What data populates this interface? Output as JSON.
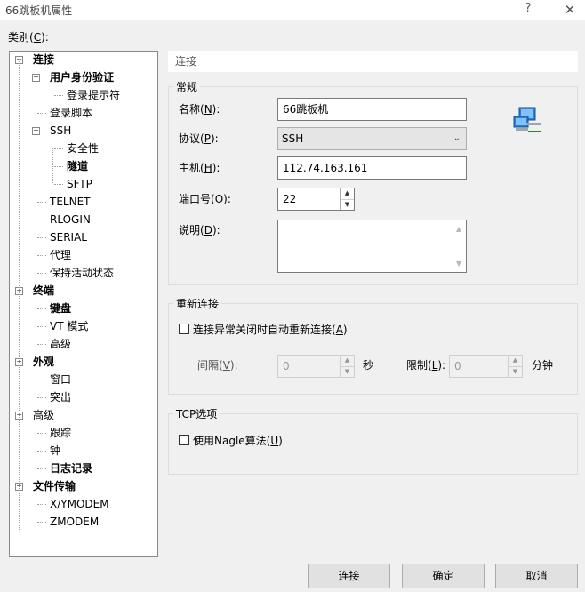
{
  "window": {
    "title": "66跳板机属性",
    "help": "?",
    "close": "✕"
  },
  "category_label": {
    "pre": "类别(",
    "key": "C",
    "post": "):"
  },
  "tree": [
    {
      "label": "连接",
      "bold": true
    },
    {
      "label": "用户身份验证",
      "bold": true
    },
    {
      "label": "登录提示符",
      "bold": false
    },
    {
      "label": "登录脚本",
      "bold": false
    },
    {
      "label": "SSH",
      "bold": false
    },
    {
      "label": "安全性",
      "bold": false
    },
    {
      "label": "隧道",
      "bold": true
    },
    {
      "label": "SFTP",
      "bold": false
    },
    {
      "label": "TELNET",
      "bold": false
    },
    {
      "label": "RLOGIN",
      "bold": false
    },
    {
      "label": "SERIAL",
      "bold": false
    },
    {
      "label": "代理",
      "bold": false
    },
    {
      "label": "保持活动状态",
      "bold": false
    },
    {
      "label": "终端",
      "bold": true
    },
    {
      "label": "键盘",
      "bold": true
    },
    {
      "label": "VT 模式",
      "bold": false
    },
    {
      "label": "高级",
      "bold": false
    },
    {
      "label": "外观",
      "bold": true
    },
    {
      "label": "窗口",
      "bold": false
    },
    {
      "label": "突出",
      "bold": false
    },
    {
      "label": "高级",
      "bold": false
    },
    {
      "label": "跟踪",
      "bold": false
    },
    {
      "label": "钟",
      "bold": false
    },
    {
      "label": "日志记录",
      "bold": true
    },
    {
      "label": "文件传输",
      "bold": true
    },
    {
      "label": "X/YMODEM",
      "bold": false
    },
    {
      "label": "ZMODEM",
      "bold": false
    }
  ],
  "panel_header": "连接",
  "general": {
    "title": "常规",
    "name_label": {
      "pre": "名称(",
      "key": "N",
      "post": "):"
    },
    "name_value": "66跳板机",
    "protocol_label": {
      "pre": "协议(",
      "key": "P",
      "post": "):"
    },
    "protocol_value": "SSH",
    "host_label": {
      "pre": "主机(",
      "key": "H",
      "post": "):"
    },
    "host_value": "112.74.163.161",
    "port_label": {
      "pre": "端口号(",
      "key": "O",
      "post": "):"
    },
    "port_value": "22",
    "desc_label": {
      "pre": "说明(",
      "key": "D",
      "post": "):"
    },
    "desc_value": ""
  },
  "reconnect": {
    "title": "重新连接",
    "checkbox_label": {
      "pre": "连接异常关闭时自动重新连接(",
      "key": "A",
      "post": ")"
    },
    "checked": false,
    "interval_label": {
      "pre": "间隔(",
      "key": "V",
      "post": "):"
    },
    "interval_value": "0",
    "interval_unit": "秒",
    "limit_label": {
      "pre": "限制(",
      "key": "L",
      "post": "):"
    },
    "limit_value": "0",
    "limit_unit": "分钟"
  },
  "tcp": {
    "title": "TCP选项",
    "nagle_label": {
      "pre": "使用Nagle算法(",
      "key": "U",
      "post": ")"
    },
    "checked": false
  },
  "buttons": {
    "connect": "连接",
    "ok": "确定",
    "cancel": "取消"
  },
  "icons": {
    "network": "network-computers-icon"
  }
}
